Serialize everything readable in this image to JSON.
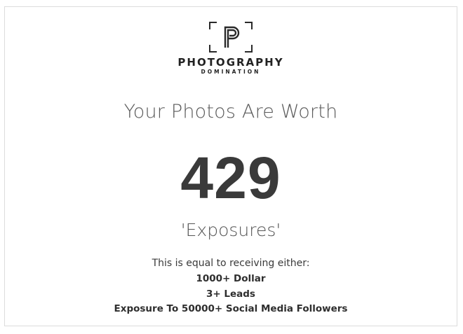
{
  "brand": {
    "logo_letter": "P",
    "name": "PHOTOGRAPHY",
    "subtitle": "DOMINATION"
  },
  "result": {
    "headline": "Your Photos Are Worth",
    "score": "429",
    "unit": "'Exposures'",
    "equal_text": "This is equal to receiving either:",
    "rewards": [
      "1000+ Dollar",
      "3+ Leads",
      "Exposure To 50000+ Social Media Followers"
    ]
  },
  "colors": {
    "text_dark": "#3a3a3a",
    "text_light": "#5a5a5a",
    "border": "#dcdcdc",
    "background": "#ffffff"
  },
  "icons": {
    "logo": "camera-viewfinder-p-logo-icon"
  }
}
